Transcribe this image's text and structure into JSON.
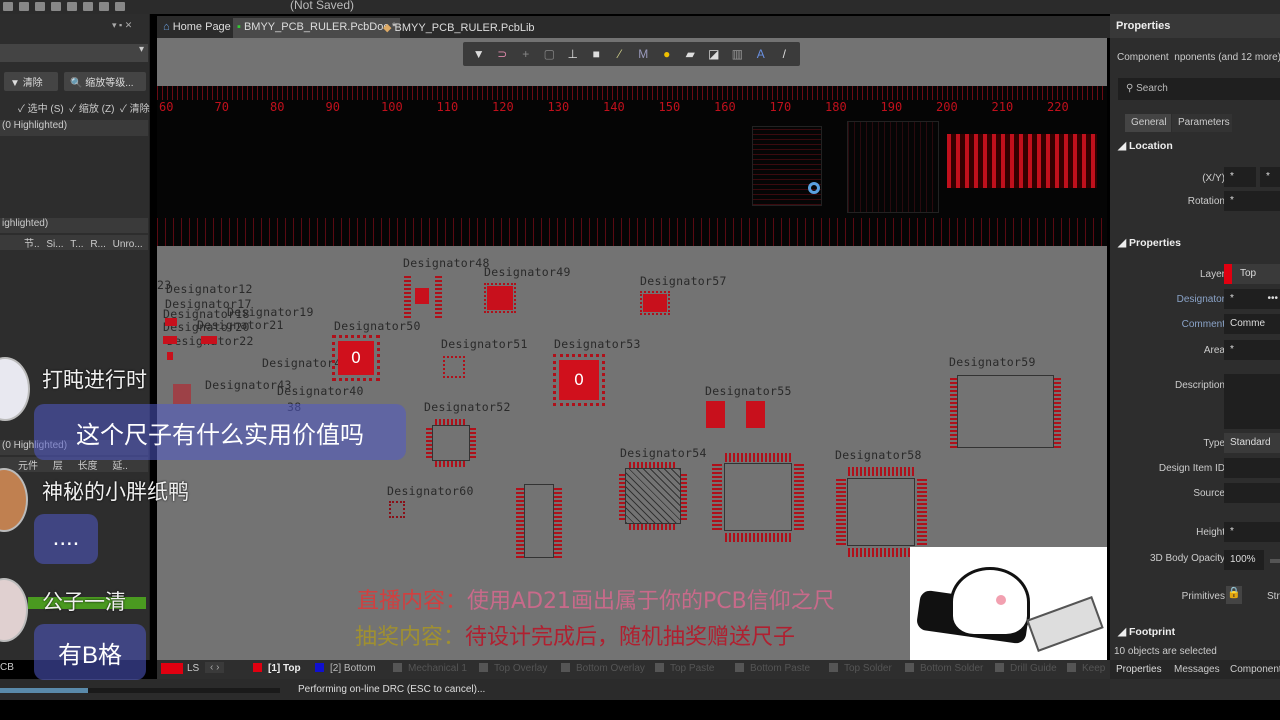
{
  "app": {
    "save_state": "(Not Saved)"
  },
  "left_panel": {
    "clear_label": "清除",
    "zoom_level_label": "缩放等级...",
    "check_select": "选中 (S)",
    "check_zoom": "缩放 (Z)",
    "check_clear": "清除",
    "highlighted_1": "(0 Highlighted)",
    "highlighted_2": "ighlighted)",
    "columns_1": [
      "节..",
      "Si...",
      "T...",
      "R...",
      "Unro..."
    ],
    "highlighted_3": "(0 Highlighted)",
    "columns_2": [
      "元件",
      "层",
      "长度",
      "延.."
    ],
    "bottom_label": "CB"
  },
  "tabs": [
    {
      "label": "Home Page"
    },
    {
      "label": "BMYY_PCB_RULER.PcbDoc *"
    },
    {
      "label": "BMYY_PCB_RULER.PcbLib"
    }
  ],
  "toolbar": [
    "filter",
    "route",
    "plus",
    "rect",
    "chart",
    "pad",
    "wand",
    "path",
    "bulb",
    "fill",
    "box",
    "bars",
    "text",
    "line"
  ],
  "ruler": {
    "numbers": [
      "60",
      "70",
      "80",
      "90",
      "100",
      "110",
      "120",
      "130",
      "140",
      "150",
      "160",
      "170",
      "180",
      "190",
      "200",
      "210",
      "220"
    ]
  },
  "designators": {
    "d12": "Designator12",
    "d17": "Designator17",
    "d18": "Designator18",
    "d19": "Designator19",
    "d20": "Designator20",
    "d21": "Designator21",
    "d22": "Designator22",
    "d23": "23",
    "d42": "Designator42",
    "d43": "Designator43",
    "d40": "Designator40",
    "d38": "38",
    "d48": "Designator48",
    "d49": "Designator49",
    "d50": "Designator50",
    "d51": "Designator51",
    "d52": "Designator52",
    "d53": "Designator53",
    "d54": "Designator54",
    "d55": "Designator55",
    "d57": "Designator57",
    "d58": "Designator58",
    "d59": "Designator59",
    "d60": "Designator60",
    "zero": "0"
  },
  "properties": {
    "title": "Properties",
    "component_label": "Component",
    "component_value": "nponents (and 12 more)",
    "search_placeholder": "Search",
    "tab_general": "General",
    "tab_parameters": "Parameters",
    "location": "Location",
    "xy_label": "(X/Y)",
    "rotation_label": "Rotation",
    "star": "*",
    "properties_section": "Properties",
    "layer_label": "Layer",
    "layer_value": "Top",
    "designator_label": "Designator",
    "comment_label": "Comment",
    "comment_value": "Comme",
    "area_label": "Area",
    "description_label": "Description",
    "type_label": "Type",
    "type_value": "Standard",
    "design_item_label": "Design Item ID",
    "source_label": "Source",
    "height_label": "Height",
    "opacity_label": "3D Body Opacity",
    "opacity_value": "100%",
    "primitives_label": "Primitives",
    "primitives_extra": "Str",
    "footprint": "Footprint",
    "selected_count": "10 objects are selected",
    "bottom_tabs": [
      "Properties",
      "Messages",
      "Components"
    ]
  },
  "layers": {
    "ls": "LS",
    "items": [
      "[1] Top",
      "[2] Bottom",
      "Mechanical 1",
      "Top Overlay",
      "Bottom Overlay",
      "Top Paste",
      "Bottom Paste",
      "Top Solder",
      "Bottom Solder",
      "Drill Guide",
      "Keep"
    ],
    "top_color": "#e00010",
    "bottom_color": "#1010d0"
  },
  "status": {
    "text": "Performing on-line DRC (ESC to cancel)...",
    "progress": 0.09
  },
  "chat": [
    {
      "name": "打盹进行时",
      "message": "这个尺子有什么实用价值吗"
    },
    {
      "name": "神秘的小胖纸鸭",
      "message": "...."
    },
    {
      "name": "公子一清",
      "message": "有B格"
    }
  ],
  "overlay": {
    "line1_label": "直播内容：",
    "line1_text": "使用AD21画出属于你的PCB信仰之尺",
    "line2_label": "抽奖内容：",
    "line2_text": "待设计完成后，随机抽奖赠送尺子"
  }
}
